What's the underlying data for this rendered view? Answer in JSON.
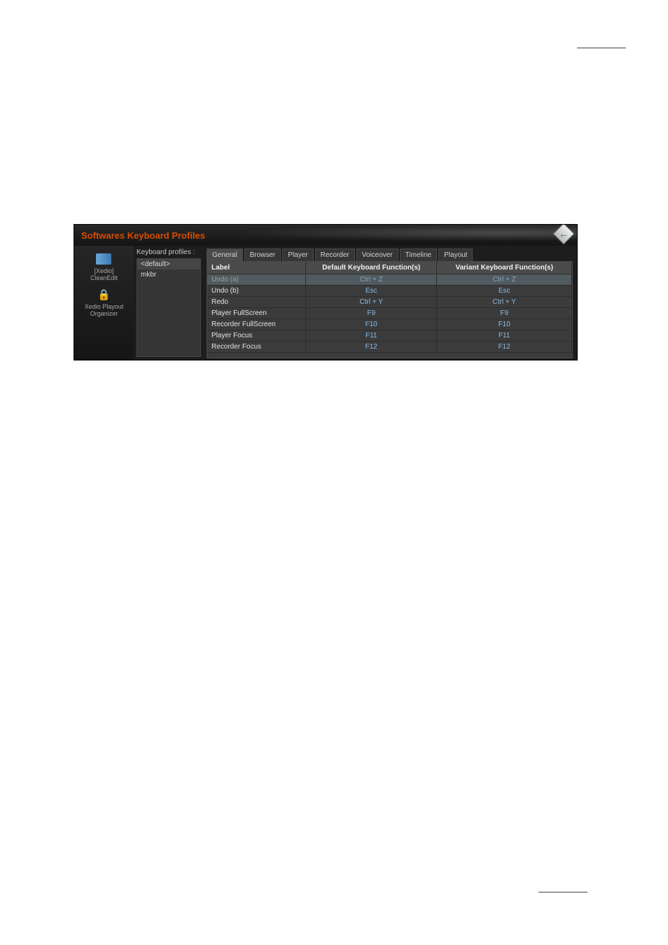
{
  "header_underline": "",
  "app": {
    "title": "Softwares Keyboard Profiles",
    "sidebar": {
      "items": [
        {
          "label_line1": "[Xedio]",
          "label_line2": "CleanEdit"
        },
        {
          "label_line1": "Xedio Playout",
          "label_line2": "Organizer"
        }
      ]
    },
    "profiles": {
      "label": "Keyboard profiles :",
      "items": [
        "<default>",
        "mkbr"
      ]
    },
    "tabs": [
      "General",
      "Browser",
      "Player",
      "Recorder",
      "Voiceover",
      "Timeline",
      "Playout"
    ],
    "active_tab": "General",
    "columns": [
      "Label",
      "Default Keyboard Function(s)",
      "Variant Keyboard Function(s)"
    ],
    "rows": [
      {
        "label": "Undo (a)",
        "default": "Ctrl + Z",
        "variant": "Ctrl + Z",
        "selected": true
      },
      {
        "label": "Undo (b)",
        "default": "Esc",
        "variant": "Esc"
      },
      {
        "label": "Redo",
        "default": "Ctrl + Y",
        "variant": "Ctrl + Y"
      },
      {
        "label": "Player FullScreen",
        "default": "F9",
        "variant": "F9"
      },
      {
        "label": "Recorder FullScreen",
        "default": "F10",
        "variant": "F10"
      },
      {
        "label": "Player Focus",
        "default": "F11",
        "variant": "F11"
      },
      {
        "label": "Recorder Focus",
        "default": "F12",
        "variant": "F12"
      }
    ]
  }
}
